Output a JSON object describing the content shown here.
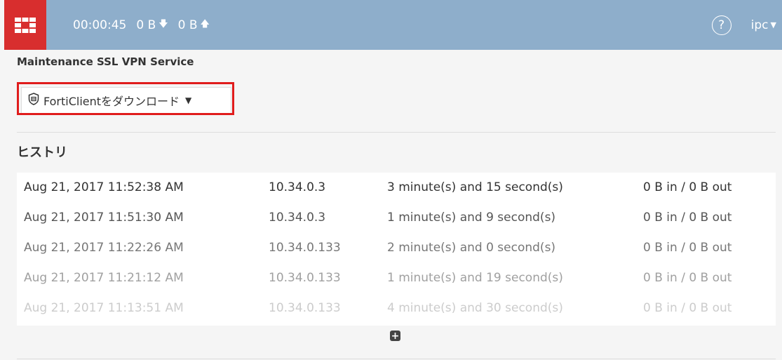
{
  "header": {
    "timer": "00:00:45",
    "bytes_down": "0 B",
    "bytes_up": "0 B",
    "user": "ipc"
  },
  "service_title": "Maintenance SSL VPN Service",
  "download_label": "FortiClientをダウンロード",
  "history": {
    "title": "ヒストリ",
    "rows": [
      {
        "date": "Aug 21, 2017 11:52:38 AM",
        "ip": "10.34.0.3",
        "duration": "3 minute(s) and 15 second(s)",
        "traffic": "0 B in / 0 B out",
        "color": "#333333"
      },
      {
        "date": "Aug 21, 2017 11:51:30 AM",
        "ip": "10.34.0.3",
        "duration": "1 minute(s) and 9 second(s)",
        "traffic": "0 B in / 0 B out",
        "color": "#555555"
      },
      {
        "date": "Aug 21, 2017 11:22:26 AM",
        "ip": "10.34.0.133",
        "duration": "2 minute(s) and 0 second(s)",
        "traffic": "0 B in / 0 B out",
        "color": "#777777"
      },
      {
        "date": "Aug 21, 2017 11:21:12 AM",
        "ip": "10.34.0.133",
        "duration": "1 minute(s) and 19 second(s)",
        "traffic": "0 B in / 0 B out",
        "color": "#a0a0a0"
      },
      {
        "date": "Aug 21, 2017 11:13:51 AM",
        "ip": "10.34.0.133",
        "duration": "4 minute(s) and 30 second(s)",
        "traffic": "0 B in / 0 B out",
        "color": "#cccccc"
      }
    ]
  },
  "colors": {
    "header_bg": "#8eaecb",
    "logo_bg": "#d82e2e",
    "highlight": "#e01c1c"
  }
}
